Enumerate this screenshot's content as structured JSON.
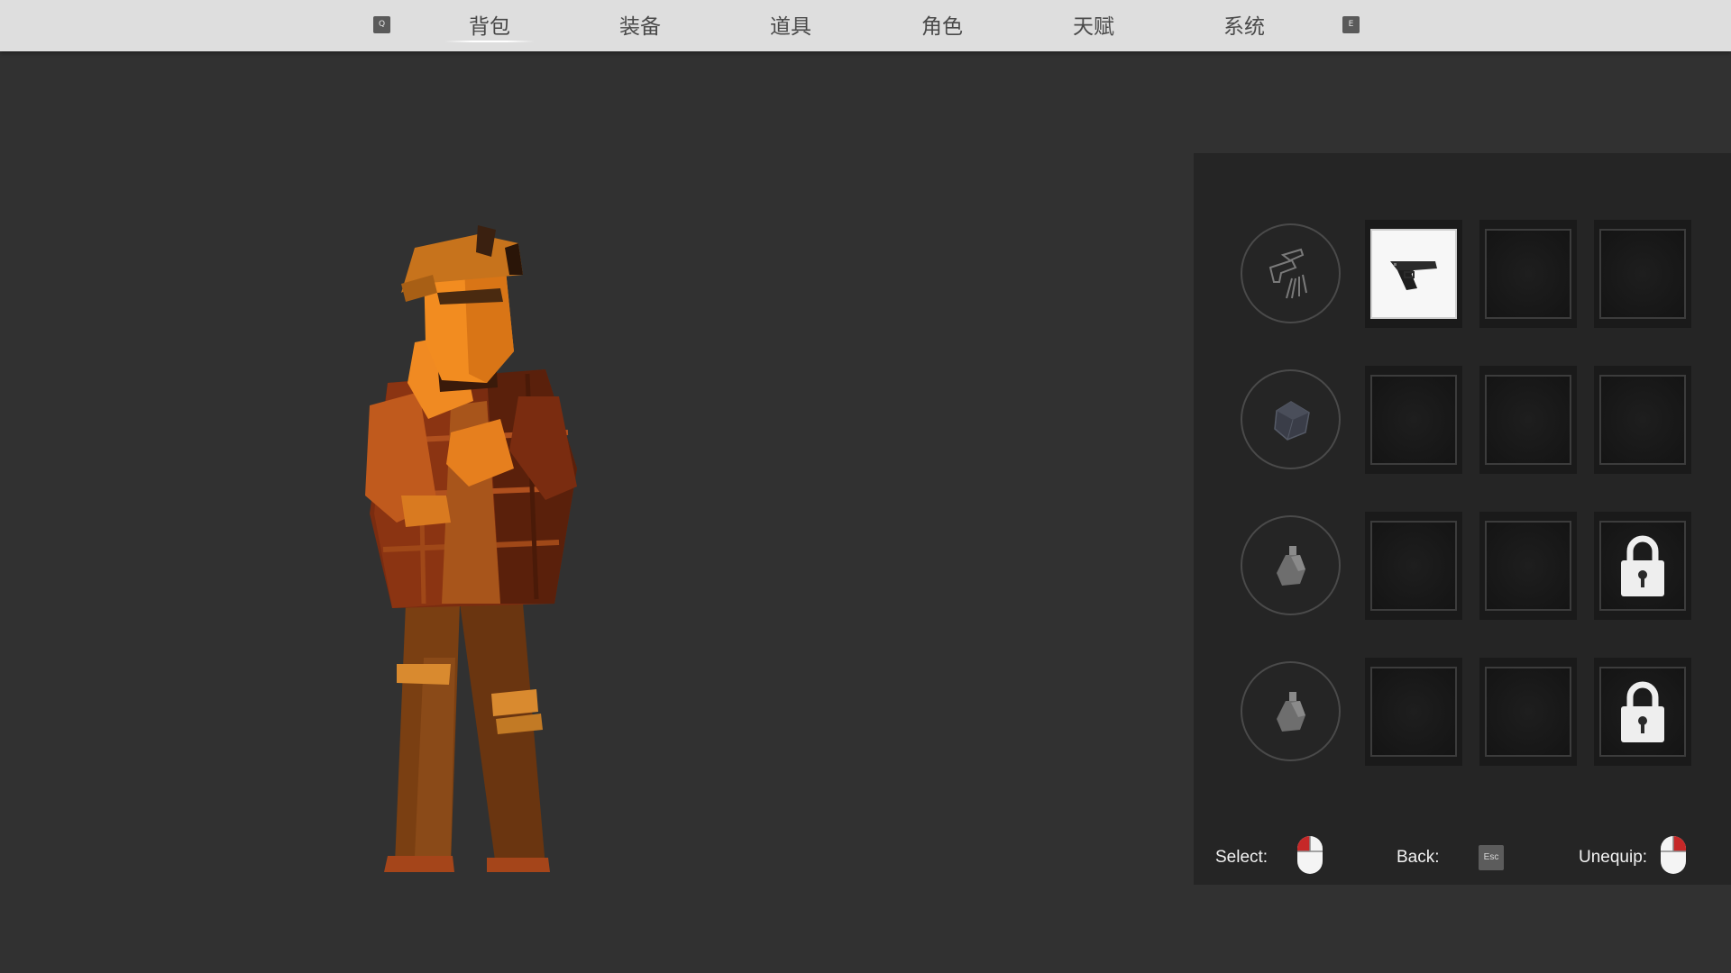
{
  "top_menu": {
    "left_key": "Q",
    "right_key": "E",
    "tabs": [
      {
        "label": "背包",
        "active": true
      },
      {
        "label": "装备",
        "active": false
      },
      {
        "label": "道具",
        "active": false
      },
      {
        "label": "角色",
        "active": false
      },
      {
        "label": "天赋",
        "active": false
      },
      {
        "label": "系统",
        "active": false
      }
    ]
  },
  "inventory": {
    "rows": [
      {
        "category_icon": "weapon-category-icon",
        "slots": [
          "pistol",
          "empty",
          "empty"
        ]
      },
      {
        "category_icon": "armor-category-icon",
        "slots": [
          "empty",
          "empty",
          "empty"
        ]
      },
      {
        "category_icon": "bottle-category-icon",
        "slots": [
          "empty",
          "empty",
          "locked"
        ]
      },
      {
        "category_icon": "bottle-category-icon",
        "slots": [
          "empty",
          "empty",
          "locked"
        ]
      }
    ]
  },
  "controls": {
    "select_label": "Select:",
    "back_label": "Back:",
    "back_key": "Esc",
    "unequip_label": "Unequip:"
  },
  "colors": {
    "background": "#313131",
    "panel": "#252525",
    "topbar": "#dedede",
    "mouse_button_highlight": "#c62828",
    "character_orange": "#e8871e"
  }
}
